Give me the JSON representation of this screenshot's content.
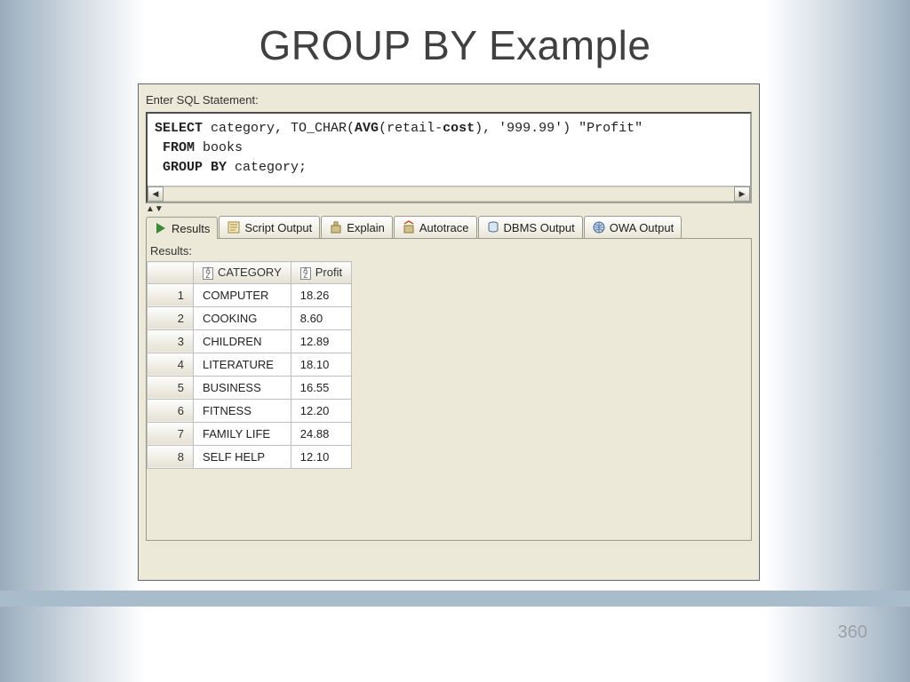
{
  "slide": {
    "title": "GROUP BY Example",
    "page_number": "360"
  },
  "sql": {
    "label": "Enter SQL Statement:",
    "line1_pre": "SELECT",
    "line1_mid1": " category, TO_CHAR(",
    "line1_avg": "AVG",
    "line1_mid2": "(retail-",
    "line1_cost": "cost",
    "line1_tail": "), '999.99') \"Profit\"",
    "line2_pre": " FROM",
    "line2_tail": " books",
    "line3_pre": " GROUP BY",
    "line3_tail": " category;"
  },
  "tabs": {
    "results": "Results",
    "script_output": "Script Output",
    "explain": "Explain",
    "autotrace": "Autotrace",
    "dbms_output": "DBMS Output",
    "owa_output": "OWA Output"
  },
  "results": {
    "label": "Results:",
    "columns": {
      "category": "CATEGORY",
      "profit": "Profit"
    },
    "rows": [
      {
        "n": "1",
        "category": "COMPUTER",
        "profit": "18.26"
      },
      {
        "n": "2",
        "category": "COOKING",
        "profit": " 8.60"
      },
      {
        "n": "3",
        "category": "CHILDREN",
        "profit": "12.89"
      },
      {
        "n": "4",
        "category": "LITERATURE",
        "profit": "18.10"
      },
      {
        "n": "5",
        "category": "BUSINESS",
        "profit": "16.55"
      },
      {
        "n": "6",
        "category": "FITNESS",
        "profit": "12.20"
      },
      {
        "n": "7",
        "category": "FAMILY LIFE",
        "profit": "24.88"
      },
      {
        "n": "8",
        "category": "SELF HELP",
        "profit": "12.10"
      }
    ]
  }
}
